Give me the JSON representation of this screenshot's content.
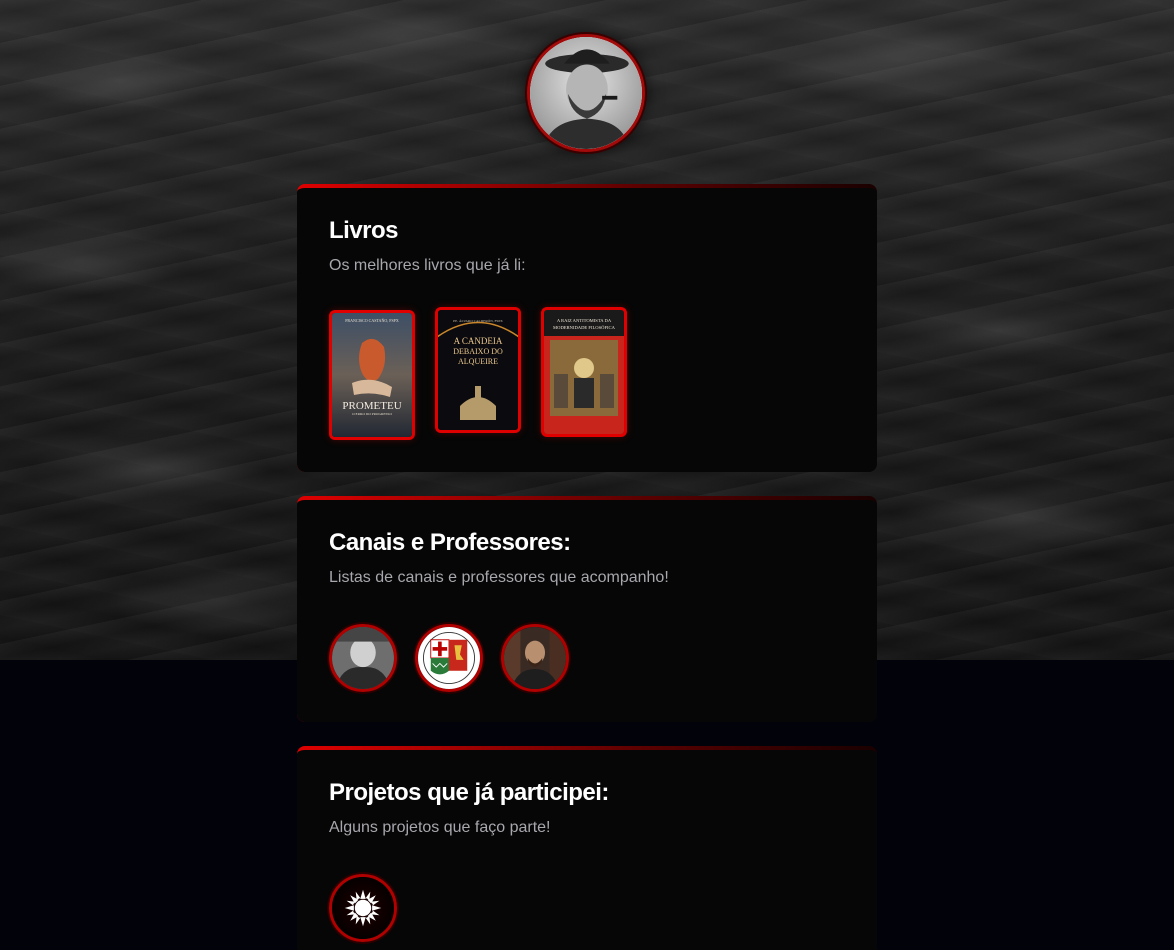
{
  "profile": {
    "avatar_icon": "profile-photo"
  },
  "sections": [
    {
      "title": "Livros",
      "subtitle": "Os melhores livros que já li:"
    },
    {
      "title": "Canais e Professores:",
      "subtitle": "Listas de canais e professores que acompanho!"
    },
    {
      "title": "Projetos que já participei:",
      "subtitle": "Alguns projetos que faço parte!"
    }
  ],
  "books": [
    {
      "author": "FRANCISCO CASTAÑO, FSPX",
      "title": "PROMETEU",
      "subtitle": "O ERRO DO PROGRESSO"
    },
    {
      "author": "PE. ÁLVARO CALDERÓN, FSPX",
      "title_line1": "A CANDEIA",
      "title_line2": "DEBAIXO DO",
      "title_line3": "ALQUEIRE"
    },
    {
      "title_line1": "A RAIZ ANTITOMISTA DA",
      "title_line2": "MODERNIDADE FILOSÓFICA"
    }
  ],
  "colors": {
    "accent": "#e00000",
    "card_bg": "#060606",
    "page_bg": "#02030a",
    "subtitle": "#a7a7ad"
  }
}
